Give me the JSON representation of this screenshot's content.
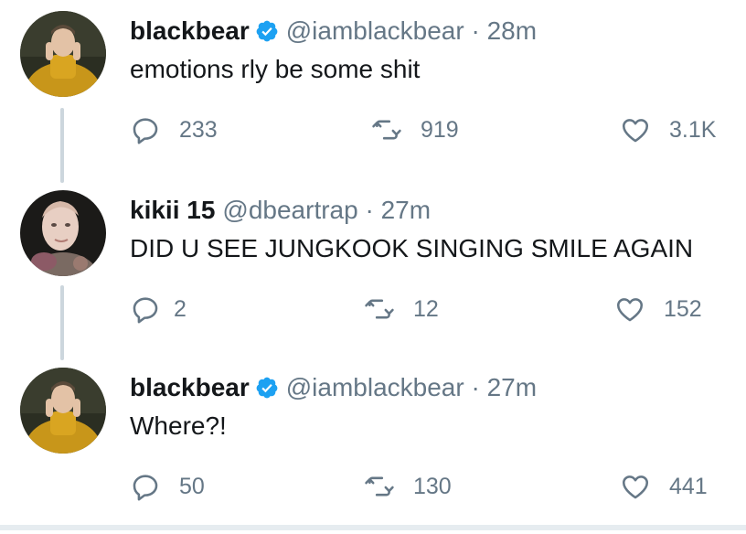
{
  "colors": {
    "text": "#14171a",
    "secondary": "#657786",
    "verified": "#1da1f2",
    "thread_line": "#ccd6dd"
  },
  "tweets": [
    {
      "name": "blackbear",
      "verified": true,
      "handle": "@iamblackbear",
      "separator": "·",
      "time": "28m",
      "text": "emotions rly be some shit",
      "replies": "233",
      "retweets": "919",
      "likes": "3.1K",
      "avatar": "avatar-blackbear"
    },
    {
      "name": "kikii 15",
      "verified": false,
      "handle": "@dbeartrap",
      "separator": "·",
      "time": "27m",
      "text": "DID U SEE JUNGKOOK SINGING SMILE AGAIN",
      "replies": "2",
      "retweets": "12",
      "likes": "152",
      "avatar": "avatar-kikii"
    },
    {
      "name": "blackbear",
      "verified": true,
      "handle": "@iamblackbear",
      "separator": "·",
      "time": "27m",
      "text": "Where?!",
      "replies": "50",
      "retweets": "130",
      "likes": "441",
      "avatar": "avatar-blackbear"
    }
  ]
}
